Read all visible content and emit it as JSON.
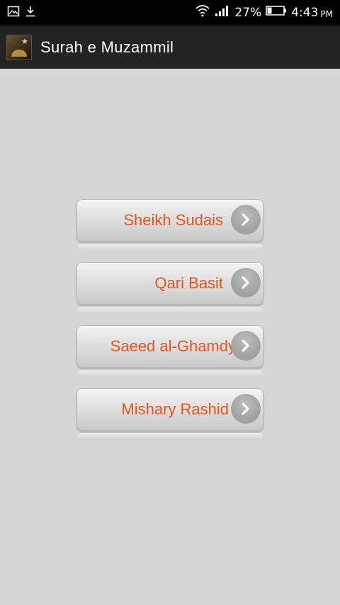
{
  "status_bar": {
    "left_icons": [
      "image-icon",
      "download-icon"
    ],
    "right_icons": [
      "wifi-icon",
      "signal-icon",
      "battery-icon"
    ],
    "battery_percent": "27%",
    "time": "4:43",
    "ampm": "PM"
  },
  "action_bar": {
    "title": "Surah e Muzammil",
    "icon": "app-logo-icon"
  },
  "menu": {
    "items": [
      {
        "label": "Sheikh Sudais"
      },
      {
        "label": "Qari Basit"
      },
      {
        "label": "Saeed al-Ghamdy"
      },
      {
        "label": "Mishary Rashid"
      }
    ],
    "chevron_icon": "chevron-right-icon"
  },
  "colors": {
    "accent_text": "#e8541c",
    "background": "#d6d6d6",
    "action_bar": "#232323",
    "status_bar": "#000000"
  }
}
